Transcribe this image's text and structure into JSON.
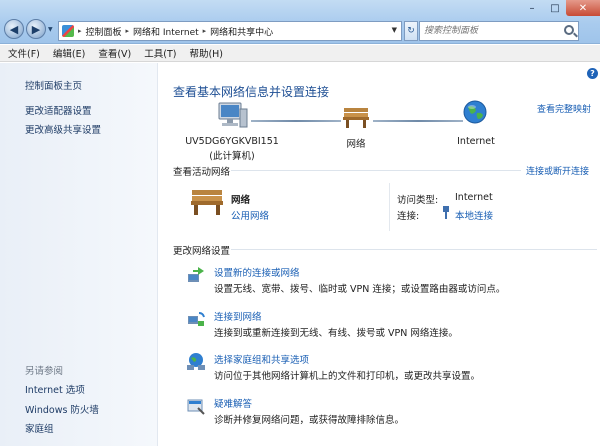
{
  "window": {
    "minimize": "–",
    "maximize": "□",
    "close": "✕"
  },
  "address_bar": {
    "back": "◀",
    "forward": "▶",
    "crumbs": [
      "控制面板",
      "网络和 Internet",
      "网络和共享中心"
    ],
    "separator": "▸",
    "refresh": "↻",
    "search_placeholder": "搜索控制面板"
  },
  "menu": [
    "文件(F)",
    "编辑(E)",
    "查看(V)",
    "工具(T)",
    "帮助(H)"
  ],
  "sidebar": {
    "links": [
      "控制面板主页",
      "更改适配器设置",
      "更改高级共享设置"
    ],
    "see_also_title": "另请参阅",
    "see_also": [
      "Internet 选项",
      "Windows 防火墙",
      "家庭组"
    ]
  },
  "main": {
    "help": "?",
    "title": "查看基本网络信息并设置连接",
    "see_full_map": "查看完整映射",
    "nodes": {
      "computer_name": "UV5DG6YGKVBI151",
      "computer_sub": "(此计算机)",
      "network": "网络",
      "internet": "Internet"
    },
    "active_header": "查看活动网络",
    "connect_disconnect": "连接或断开连接",
    "network": {
      "name": "网络",
      "type": "公用网络",
      "access_label": "访问类型:",
      "access_value": "Internet",
      "conn_label": "连接:",
      "conn_value": "本地连接"
    },
    "change_header": "更改网络设置",
    "tasks": [
      {
        "title": "设置新的连接或网络",
        "desc": "设置无线、宽带、拨号、临时或 VPN 连接；或设置路由器或访问点。"
      },
      {
        "title": "连接到网络",
        "desc": "连接到或重新连接到无线、有线、拨号或 VPN 网络连接。"
      },
      {
        "title": "选择家庭组和共享选项",
        "desc": "访问位于其他网络计算机上的文件和打印机，或更改共享设置。"
      },
      {
        "title": "疑难解答",
        "desc": "诊断并修复网络问题，或获得故障排除信息。"
      }
    ]
  },
  "colors": {
    "link": "#1a5fb4",
    "title": "#1e4f94",
    "titlebar": "#a9cbee"
  }
}
